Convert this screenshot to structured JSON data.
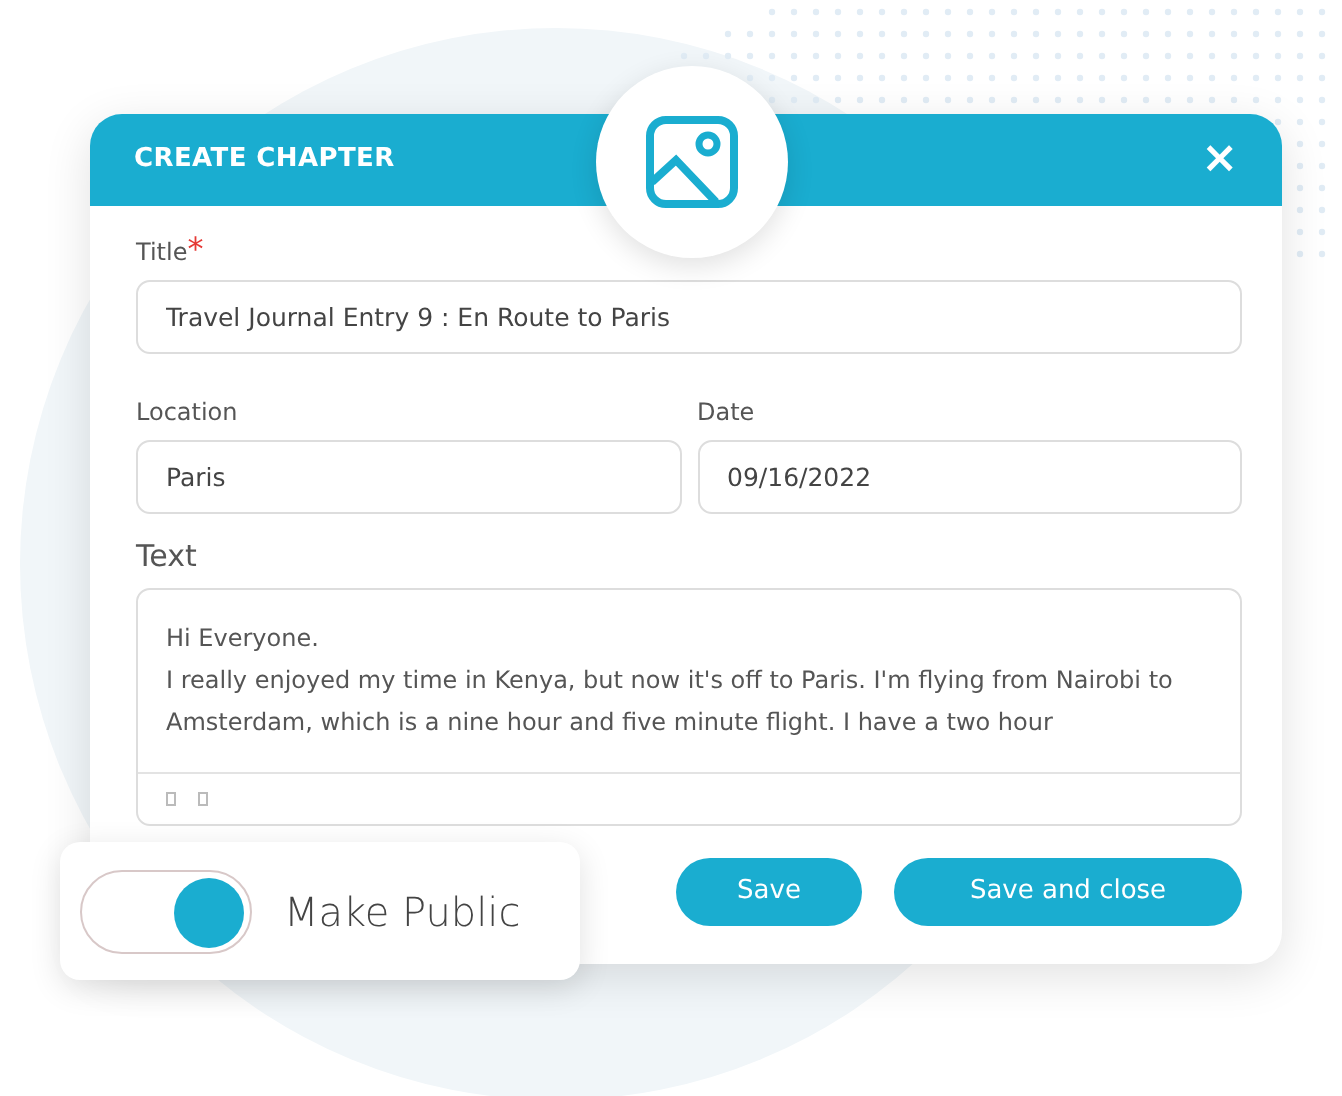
{
  "dialog": {
    "title": "CREATE CHAPTER",
    "close": "×",
    "fields": [
      {
        "label": "Title",
        "required_mark": "*",
        "value": "Travel Journal Entry 9 : En Route to Paris"
      },
      {
        "label": "Location",
        "value": "Paris"
      },
      {
        "label": "Date",
        "value": "09/16/2022"
      }
    ],
    "text": {
      "label": "Text",
      "lines": [
        "Hi Everyone.",
        "I really enjoyed my time in Kenya, but now it's off to Paris. I'm flying from Nairobi to Amsterdam, which is a nine hour and five minute flight. I have a two hour"
      ]
    },
    "buttons": [
      "Save",
      "Save and close"
    ]
  },
  "toggle": {
    "label": "Make Public",
    "on": true
  }
}
